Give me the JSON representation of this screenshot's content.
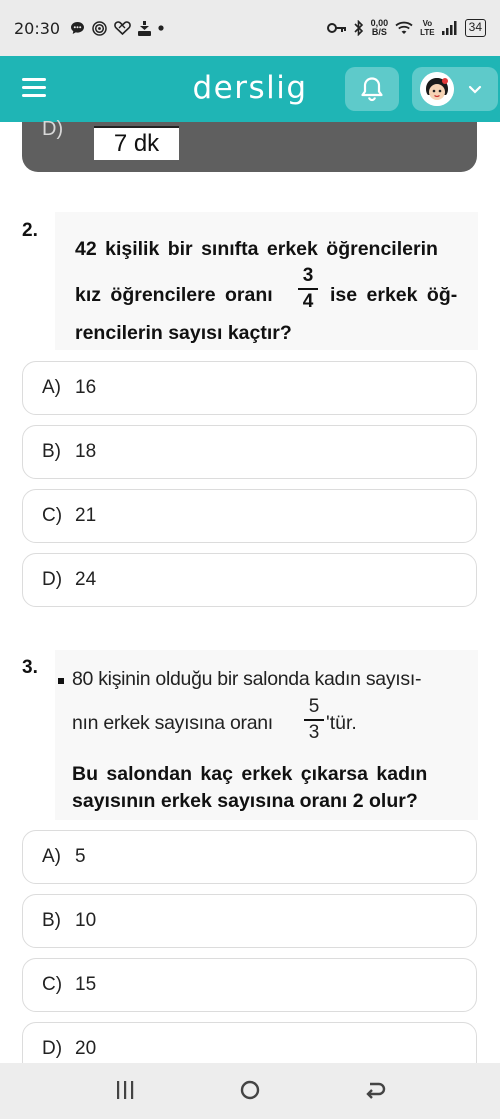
{
  "status_bar": {
    "time": "20:30",
    "net_speed_value": "0,00",
    "net_speed_unit": "B/S",
    "volte_top": "Vo",
    "volte_bottom": "LTE",
    "battery": "34"
  },
  "header": {
    "logo": "derslig"
  },
  "prev_question": {
    "option_letter": "D)",
    "option_value": "7 dk"
  },
  "questions": [
    {
      "number": "2.",
      "lines": [
        "42 kişilik bir sınıfta erkek öğrencilerin",
        "kız öğrencilere oranı",
        "ise erkek öğ-",
        "rencilerin sayısı kaçtır?"
      ],
      "fraction": {
        "numerator": "3",
        "denominator": "4"
      },
      "options": [
        {
          "letter": "A)",
          "value": "16"
        },
        {
          "letter": "B)",
          "value": "18"
        },
        {
          "letter": "C)",
          "value": "21"
        },
        {
          "letter": "D)",
          "value": "24"
        }
      ]
    },
    {
      "number": "3.",
      "lines": [
        "80 kişinin olduğu bir salonda kadın sayısı-",
        "nın erkek sayısına oranı",
        "'tür.",
        "Bu salondan kaç erkek çıkarsa kadın",
        "sayısının erkek sayısına oranı 2 olur?"
      ],
      "fraction": {
        "numerator": "5",
        "denominator": "3"
      },
      "options": [
        {
          "letter": "A)",
          "value": "5"
        },
        {
          "letter": "B)",
          "value": "10"
        },
        {
          "letter": "C)",
          "value": "15"
        },
        {
          "letter": "D)",
          "value": "20"
        }
      ]
    }
  ],
  "colors": {
    "brand": "#1fb5b5",
    "brand_light": "#5ecaca",
    "dark_card": "#5f5f5f"
  },
  "icons": {
    "status_left": [
      "chat-bubble-icon",
      "target-icon",
      "heart-icon",
      "download-icon",
      "dot-icon"
    ],
    "status_right": [
      "key-icon",
      "bluetooth-icon",
      "wifi-icon",
      "signal-icon"
    ],
    "nav": [
      "recent-apps-icon",
      "home-icon",
      "back-icon"
    ]
  }
}
